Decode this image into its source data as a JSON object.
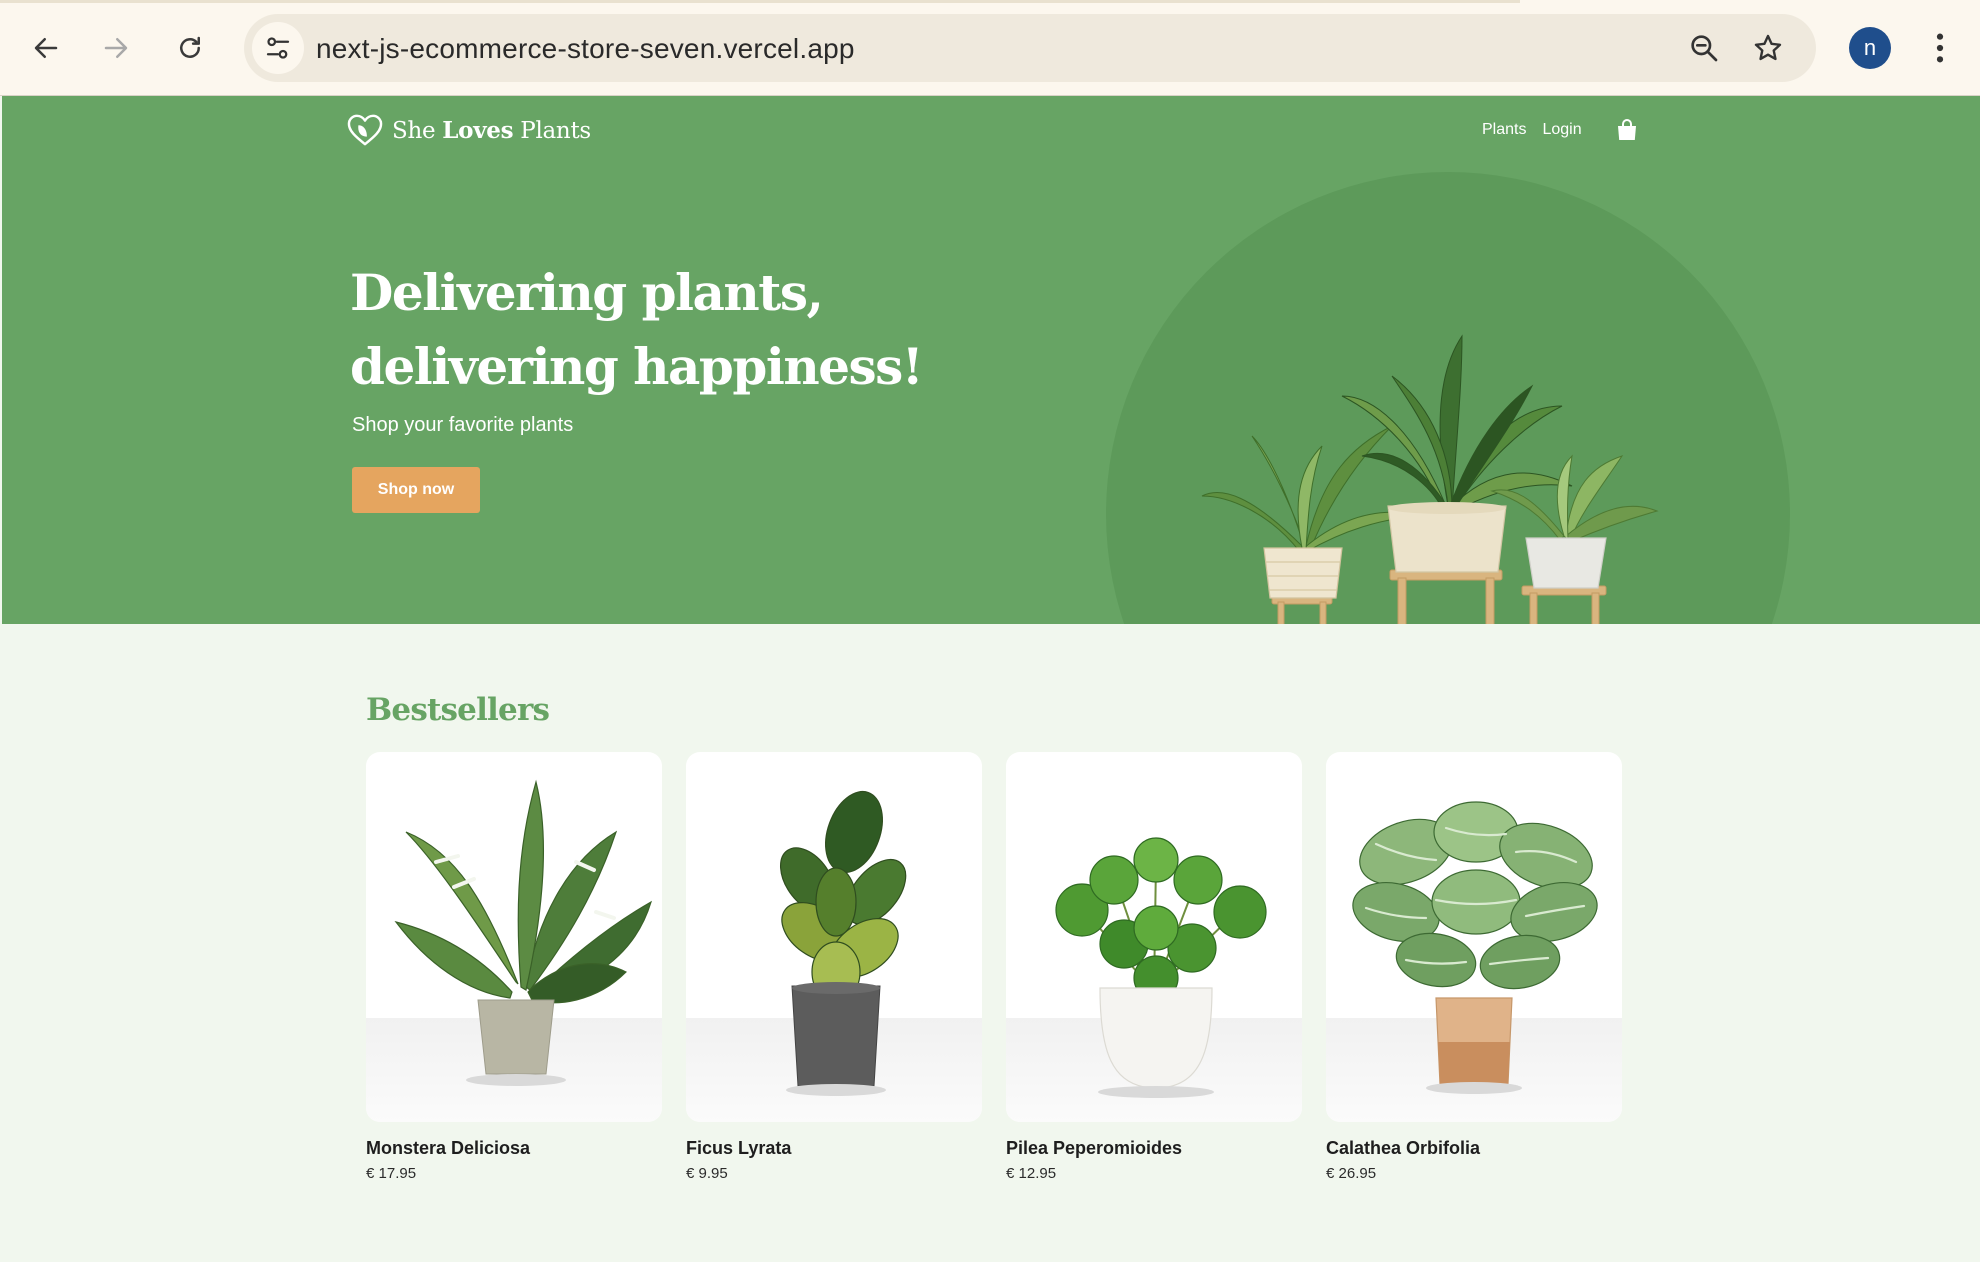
{
  "browser": {
    "url": "next-js-ecommerce-store-seven.vercel.app",
    "profile_initial": "n",
    "icons": {
      "back": "arrow-left-icon",
      "forward": "arrow-right-icon",
      "reload": "reload-icon",
      "site_info": "tune-icon",
      "zoom": "zoom-out-icon",
      "bookmark": "star-icon",
      "menu": "kebab-menu-icon"
    }
  },
  "header": {
    "logo": {
      "word1": "She",
      "word2": "Loves",
      "word3": "Plants"
    },
    "nav": [
      {
        "label": "Plants"
      },
      {
        "label": "Login"
      }
    ],
    "cart_icon": "shopping-bag-icon"
  },
  "hero": {
    "title_line1": "Delivering plants,",
    "title_line2": "delivering happiness!",
    "subtitle": "Shop your favorite plants",
    "cta_label": "Shop now"
  },
  "bestsellers": {
    "title": "Bestsellers",
    "products": [
      {
        "name": "Monstera Deliciosa",
        "price": "€ 17.95"
      },
      {
        "name": "Ficus Lyrata",
        "price": "€ 9.95"
      },
      {
        "name": "Pilea Peperomioides",
        "price": "€ 12.95"
      },
      {
        "name": "Calathea Orbifolia",
        "price": "€ 26.95"
      }
    ]
  },
  "colors": {
    "hero_green": "#67a464",
    "hero_circle": "#5d9a5a",
    "cta_orange": "#e5a55f",
    "page_background": "#f1f7ee",
    "section_title": "#67a464"
  }
}
